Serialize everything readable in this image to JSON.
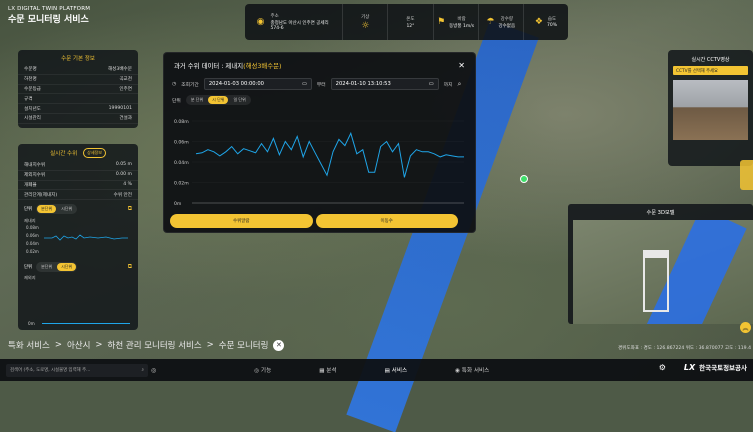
{
  "brand": {
    "en": "LX DIGITAL TWIN PLATFORM",
    "ko": "수문 모니터링 서비스"
  },
  "weather": {
    "address_label": "주소",
    "address": "충청남도 아산시 인주면 공세리 574-6",
    "sky_label": "기상",
    "temp_label": "온도",
    "temp": "12°",
    "wind_label": "바람",
    "wind": "동방풍 1m/s",
    "precip_label": "강수량",
    "precip": "강수없음",
    "humidity_label": "습도",
    "humidity": "70%"
  },
  "basic_info": {
    "title": "수문 기본 정보",
    "rows": [
      {
        "k": "수문명",
        "v": "해성3배수문"
      },
      {
        "k": "하천명",
        "v": "곡교천"
      },
      {
        "k": "수문등급",
        "v": "인주면"
      },
      {
        "k": "규격",
        "v": ""
      },
      {
        "k": "설치년도",
        "v": "19990101"
      },
      {
        "k": "시설관리",
        "v": "건설과"
      }
    ]
  },
  "realtime": {
    "title": "실시간 수위",
    "badge": "상세정보",
    "rows": [
      {
        "k": "해내지수위",
        "v": "0.05 m"
      },
      {
        "k": "제외지수위",
        "v": "0.00 m"
      },
      {
        "k": "개폐율",
        "v": "4 %"
      },
      {
        "k": "관리단계(제내지)",
        "v": "수위 안전"
      }
    ],
    "unit_label": "단위",
    "unit_opts": [
      "분단위",
      "시단위"
    ],
    "series_label1": "제내지",
    "series_label2": "제외지",
    "ticks": [
      "0.08m",
      "0.06m",
      "0.04m",
      "0.02m",
      "0m"
    ],
    "unit_opts2": [
      "분단위",
      "시단위"
    ],
    "zero": "0m"
  },
  "modal": {
    "title_prefix": "과거 수위 데이터 : 제내지",
    "title_hl": "(해성3배수문)",
    "period_label": "조회기간",
    "start": "2024-01-03 00:00:00",
    "sep": "부터",
    "end": "2024-01-10 13:10:53",
    "until": "까지",
    "unit_label": "단위",
    "units": [
      "분 단위",
      "시 단위",
      "일 단위"
    ],
    "btn_left": "수위알람",
    "btn_right": "이동수"
  },
  "cctv": {
    "title": "실시간 CCTV영상",
    "tag": "CCTV를 선택해 주세요"
  },
  "model": {
    "title": "수문 3D모델"
  },
  "breadcrumb": [
    "특화 서비스",
    "아산시",
    "하천 관리 모니터링 서비스",
    "수문 모니터링"
  ],
  "coords": "경위도좌표 : 경도 : 126.867224  위도 : 36.870077  고도 : 119.4",
  "bottom": {
    "search_placeholder": "검색어 (주소, 도로명, 시설물명 입력해 주...",
    "nav": [
      "기능",
      "분석",
      "서비스",
      "특화 서비스"
    ],
    "org": "한국국토정보공사"
  },
  "chart_data": {
    "type": "line",
    "title": "",
    "ylabel": "",
    "ylim": [
      0,
      0.08
    ],
    "y_ticks": [
      "0.08m",
      "0.06m",
      "0.04m",
      "0.02m",
      "0m"
    ],
    "series": [
      {
        "values": [
          0.048,
          0.049,
          0.052,
          0.05,
          0.046,
          0.05,
          0.055,
          0.048,
          0.053,
          0.051,
          0.049,
          0.058,
          0.05,
          0.063,
          0.047,
          0.06,
          0.052,
          0.065,
          0.045,
          0.06,
          0.049,
          0.038,
          0.027,
          0.05,
          0.062,
          0.056,
          0.068,
          0.048,
          0.052,
          0.03,
          0.03,
          0.055,
          0.06,
          0.05,
          0.058,
          0.025,
          0.046,
          0.052,
          0.05,
          0.05,
          0.048,
          0.045,
          0.047,
          0.046,
          0.045,
          0.045
        ]
      }
    ]
  },
  "colors": {
    "accent": "#f3c433",
    "line": "#1fa5e8",
    "river": "#2c78f0"
  }
}
